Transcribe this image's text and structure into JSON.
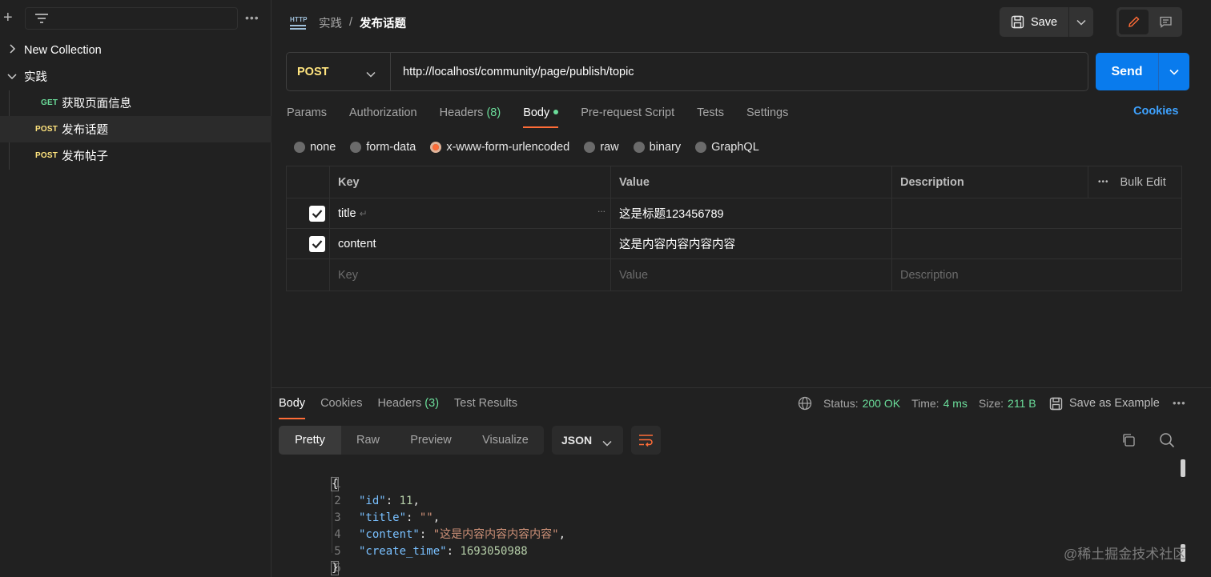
{
  "sidebar": {
    "more_label": "•••",
    "collections": [
      {
        "name": "New Collection",
        "expanded": false
      },
      {
        "name": "实践",
        "expanded": true
      }
    ],
    "requests": [
      {
        "method": "GET",
        "name": "获取页面信息"
      },
      {
        "method": "POST",
        "name": "发布话题",
        "selected": true
      },
      {
        "method": "POST",
        "name": "发布帖子"
      }
    ]
  },
  "header": {
    "breadcrumb_parent": "实践",
    "breadcrumb_sep": "/",
    "breadcrumb_current": "发布话题",
    "save_label": "Save"
  },
  "request": {
    "method": "POST",
    "url": "http://localhost/community/page/publish/topic",
    "send_label": "Send",
    "tabs": [
      {
        "label": "Params"
      },
      {
        "label": "Authorization"
      },
      {
        "label": "Headers",
        "count": "(8)"
      },
      {
        "label": "Body",
        "active": true,
        "dot": true
      },
      {
        "label": "Pre-request Script"
      },
      {
        "label": "Tests"
      },
      {
        "label": "Settings"
      }
    ],
    "cookies_label": "Cookies",
    "body_types": [
      {
        "label": "none"
      },
      {
        "label": "form-data"
      },
      {
        "label": "x-www-form-urlencoded",
        "selected": true
      },
      {
        "label": "raw"
      },
      {
        "label": "binary"
      },
      {
        "label": "GraphQL"
      }
    ],
    "table": {
      "headers": {
        "key": "Key",
        "value": "Value",
        "description": "Description",
        "bulk_edit": "Bulk Edit",
        "more": "•••"
      },
      "rows": [
        {
          "key": "title",
          "value": "这是标题123456789",
          "description": "",
          "checked": true
        },
        {
          "key": "content",
          "value": "这是内容内容内容内容",
          "description": "",
          "checked": true
        }
      ],
      "placeholders": {
        "key": "Key",
        "value": "Value",
        "description": "Description"
      }
    }
  },
  "response": {
    "tabs": [
      {
        "label": "Body",
        "active": true
      },
      {
        "label": "Cookies"
      },
      {
        "label": "Headers",
        "count": "(3)"
      },
      {
        "label": "Test Results"
      }
    ],
    "status_label": "Status:",
    "status_value": "200 OK",
    "time_label": "Time:",
    "time_value": "4 ms",
    "size_label": "Size:",
    "size_value": "211 B",
    "save_example_label": "Save as Example",
    "views": [
      "Pretty",
      "Raw",
      "Preview",
      "Visualize"
    ],
    "format": "JSON",
    "code_lines": [
      {
        "n": "1",
        "text": "{"
      },
      {
        "n": "2",
        "key": "\"id\"",
        "value": "11",
        "vtype": "num",
        "comma": ","
      },
      {
        "n": "3",
        "key": "\"title\"",
        "value": "\"\"",
        "vtype": "str",
        "comma": ","
      },
      {
        "n": "4",
        "key": "\"content\"",
        "value": "\"这是内容内容内容内容\"",
        "vtype": "str",
        "comma": ","
      },
      {
        "n": "5",
        "key": "\"create_time\"",
        "value": "1693050988",
        "vtype": "num",
        "comma": ""
      },
      {
        "n": "6",
        "text": "}"
      }
    ]
  },
  "watermark": "@稀土掘金技术社区"
}
